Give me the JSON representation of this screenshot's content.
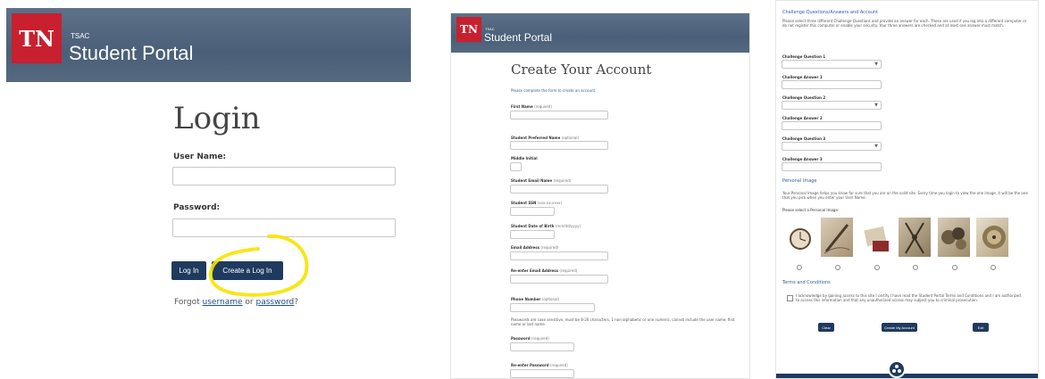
{
  "login": {
    "logo": "TN",
    "brand_small": "TSAC",
    "brand_big": "Student Portal",
    "title": "Login",
    "username_label": "User Name:",
    "password_label": "Password:",
    "login_button": "Log In",
    "create_button": "Create a Log In",
    "forgot_prefix": "Forgot",
    "forgot_username": "username",
    "forgot_or": "or",
    "forgot_password": "password",
    "forgot_suffix": "?",
    "highlight_color": "#f5e400"
  },
  "create": {
    "logo": "TN",
    "brand_small": "TSAC",
    "brand_big": "Student Portal",
    "title": "Create Your Account",
    "subtitle": "Please complete the form to create an account.",
    "fields": [
      {
        "label": "First Name",
        "note": "(required)"
      },
      {
        "label": "Student Preferred Name",
        "note": "(optional)"
      },
      {
        "label": "Middle Initial",
        "note": ""
      },
      {
        "label": "Student Email Name",
        "note": "(required)"
      },
      {
        "label": "Student SSN",
        "note": "(xxx-xx-xxxx)"
      },
      {
        "label": "Student Date of Birth",
        "note": "(mm/dd/yyyy)"
      },
      {
        "label": "Email Address",
        "note": "(required)"
      },
      {
        "label": "Re-enter Email Address",
        "note": "(required)"
      },
      {
        "label": "Phone Number",
        "note": "(optional)"
      }
    ],
    "password_rules": "Passwords are case sensitive, must be 8-20 characters, 1 non-alphabetic or one numeric, cannot include the user name, first name or last name.",
    "password_label": "Password",
    "password_note": "(required)",
    "reenter_password_label": "Re-enter Password",
    "reenter_password_note": "(required)"
  },
  "security": {
    "heading": "Challenge Questions/Answers and Account",
    "intro": "Please select three different Challenge Questions and provide an answer for each. These are used if you log into a different computer or do not register this computer or enable your security. Your three answers are checked and at least one answer must match.",
    "questions": [
      {
        "q_label": "Challenge Question 1",
        "a_label": "Challenge Answer 1"
      },
      {
        "q_label": "Challenge Question 2",
        "a_label": "Challenge Answer 2"
      },
      {
        "q_label": "Challenge Question 3",
        "a_label": "Challenge Answer 3"
      }
    ],
    "image_heading": "Personal Image",
    "image_intro": "Your Personal Image helps you know for sure that you are on the valid site. Every time you login to view the one image, it will be the one that you pick when you enter your User Name.",
    "image_select_label": "Please select a Personal Image:",
    "terms_heading": "Terms and Conditions",
    "terms_text": "I acknowledge by gaining access to this site I certify I have read the Student Portal Terms and Conditions and I am authorized to access this information and that any unauthorized access may subject you to criminal prosecution.",
    "buttons": [
      "Clear",
      "Create My Account",
      "Exit"
    ]
  }
}
